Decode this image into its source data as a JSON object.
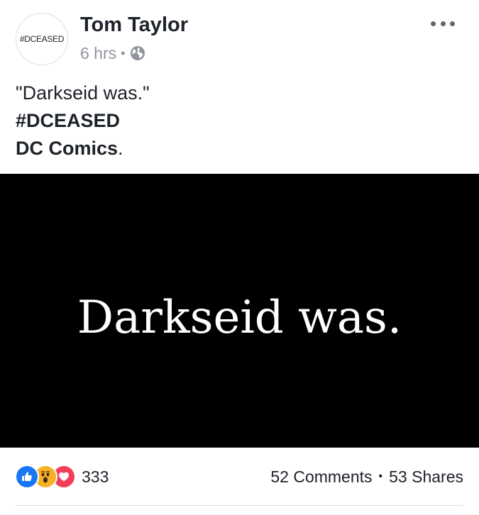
{
  "post": {
    "avatar_text": "#DCEASED",
    "author": "Tom Taylor",
    "time": "6 hrs",
    "privacy_icon": "globe-icon",
    "text_line1": "\"Darkseid was.\"",
    "hashtag": "#DCEASED",
    "page_link": "DC Comics",
    "page_link_suffix": "."
  },
  "media": {
    "caption": "Darkseid was."
  },
  "footer": {
    "reaction_icons": [
      "like-icon",
      "wow-icon",
      "love-icon"
    ],
    "reaction_count": "333",
    "comments": "52 Comments",
    "shares": "53 Shares"
  },
  "colors": {
    "text": "#1d2129",
    "meta": "#90949c",
    "like": "#1877f2",
    "wow": "#f7b125",
    "love": "#f33e58",
    "media_bg": "#000000"
  }
}
